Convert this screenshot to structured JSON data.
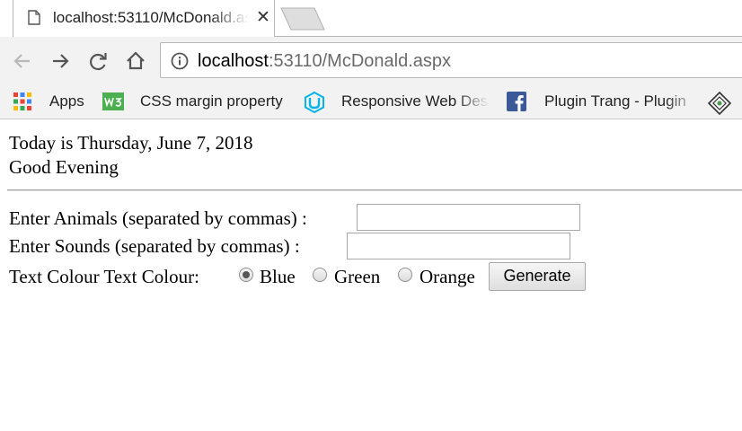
{
  "browser": {
    "tab": {
      "title": "localhost:53110/McDonald.aspx",
      "close_glyph": "✕"
    },
    "toolbar": {
      "url_host": "localhost",
      "url_rest": ":53110/McDonald.aspx"
    },
    "bookmarks": [
      {
        "label": "Apps",
        "icon": "apps-grid-icon"
      },
      {
        "label": "CSS margin property",
        "icon": "w3-icon"
      },
      {
        "label": "Responsive Web Des",
        "icon": "udacity-icon"
      },
      {
        "label": "Plugin Trang - Plugin",
        "icon": "facebook-icon"
      }
    ]
  },
  "page": {
    "date_line": "Today is Thursday, June 7, 2018",
    "greeting": "Good Evening",
    "animals_label": "Enter Animals (separated by commas) :",
    "animals_value": "",
    "sounds_label": "Enter Sounds (separated by commas) :",
    "sounds_value": "",
    "colour_label": "Text Colour Text Colour:",
    "colours": [
      {
        "label": "Blue",
        "selected": true
      },
      {
        "label": "Green",
        "selected": false
      },
      {
        "label": "Orange",
        "selected": false
      }
    ],
    "generate_label": "Generate"
  },
  "colors": {
    "toolbar_bg": "#f2f2f2",
    "w3_green": "#4caf50",
    "udacity_blue": "#02b3e4",
    "facebook_blue": "#3b5998"
  }
}
